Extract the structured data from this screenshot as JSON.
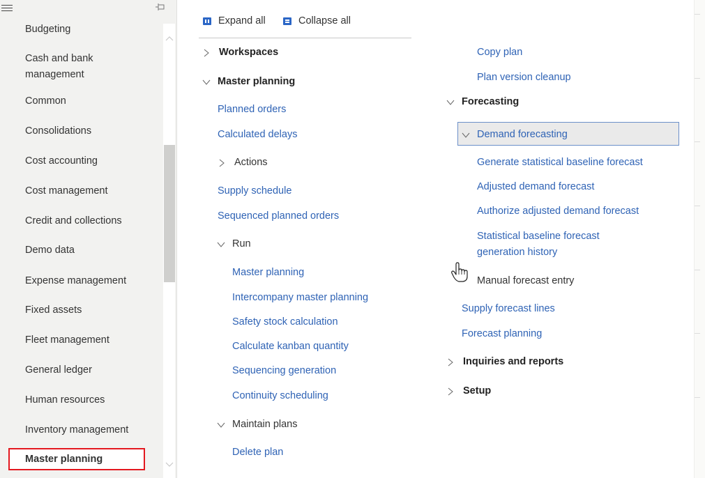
{
  "sidebar": {
    "menu_icon": "hamburger-icon",
    "pin_icon": "pin-icon",
    "items": [
      {
        "label": "Budgeting"
      },
      {
        "label": "Cash and bank management"
      },
      {
        "label": "Common"
      },
      {
        "label": "Consolidations"
      },
      {
        "label": "Cost accounting"
      },
      {
        "label": "Cost management"
      },
      {
        "label": "Credit and collections"
      },
      {
        "label": "Demo data"
      },
      {
        "label": "Expense management"
      },
      {
        "label": "Fixed assets"
      },
      {
        "label": "Fleet management"
      },
      {
        "label": "General ledger"
      },
      {
        "label": "Human resources"
      },
      {
        "label": "Inventory management"
      },
      {
        "label": "Master planning",
        "selected": true
      }
    ],
    "cash_line1": "Cash and bank",
    "cash_line2": "management",
    "highlight_color": "#e3181f"
  },
  "toolbar": {
    "expand_all": "Expand all",
    "collapse_all": "Collapse all"
  },
  "tree": {
    "left": {
      "workspaces": "Workspaces",
      "master_planning": "Master planning",
      "planned_orders": "Planned orders",
      "calculated_delays": "Calculated delays",
      "actions": "Actions",
      "supply_schedule": "Supply schedule",
      "sequenced_planned_orders": "Sequenced planned orders",
      "run": "Run",
      "run_items": [
        "Master planning",
        "Intercompany master planning",
        "Safety stock calculation",
        "Calculate kanban quantity",
        "Sequencing generation",
        "Continuity scheduling"
      ],
      "maintain_plans": "Maintain plans",
      "delete_plan": "Delete plan"
    },
    "right": {
      "copy_plan": "Copy plan",
      "plan_version_cleanup": "Plan version cleanup",
      "forecasting": "Forecasting",
      "demand_forecasting": "Demand forecasting",
      "demand_items": [
        "Generate statistical baseline forecast",
        "Adjusted demand forecast",
        "Authorize adjusted demand forecast"
      ],
      "stat_history_line1": "Statistical baseline forecast",
      "stat_history_line2": "generation history",
      "manual_forecast_entry": "Manual forecast entry",
      "supply_forecast_lines": "Supply forecast lines",
      "forecast_planning": "Forecast planning",
      "inquiries_and_reports": "Inquiries and reports",
      "setup": "Setup"
    },
    "link_color": "#2f63b5",
    "selected_border_color": "#6b8fc9"
  }
}
